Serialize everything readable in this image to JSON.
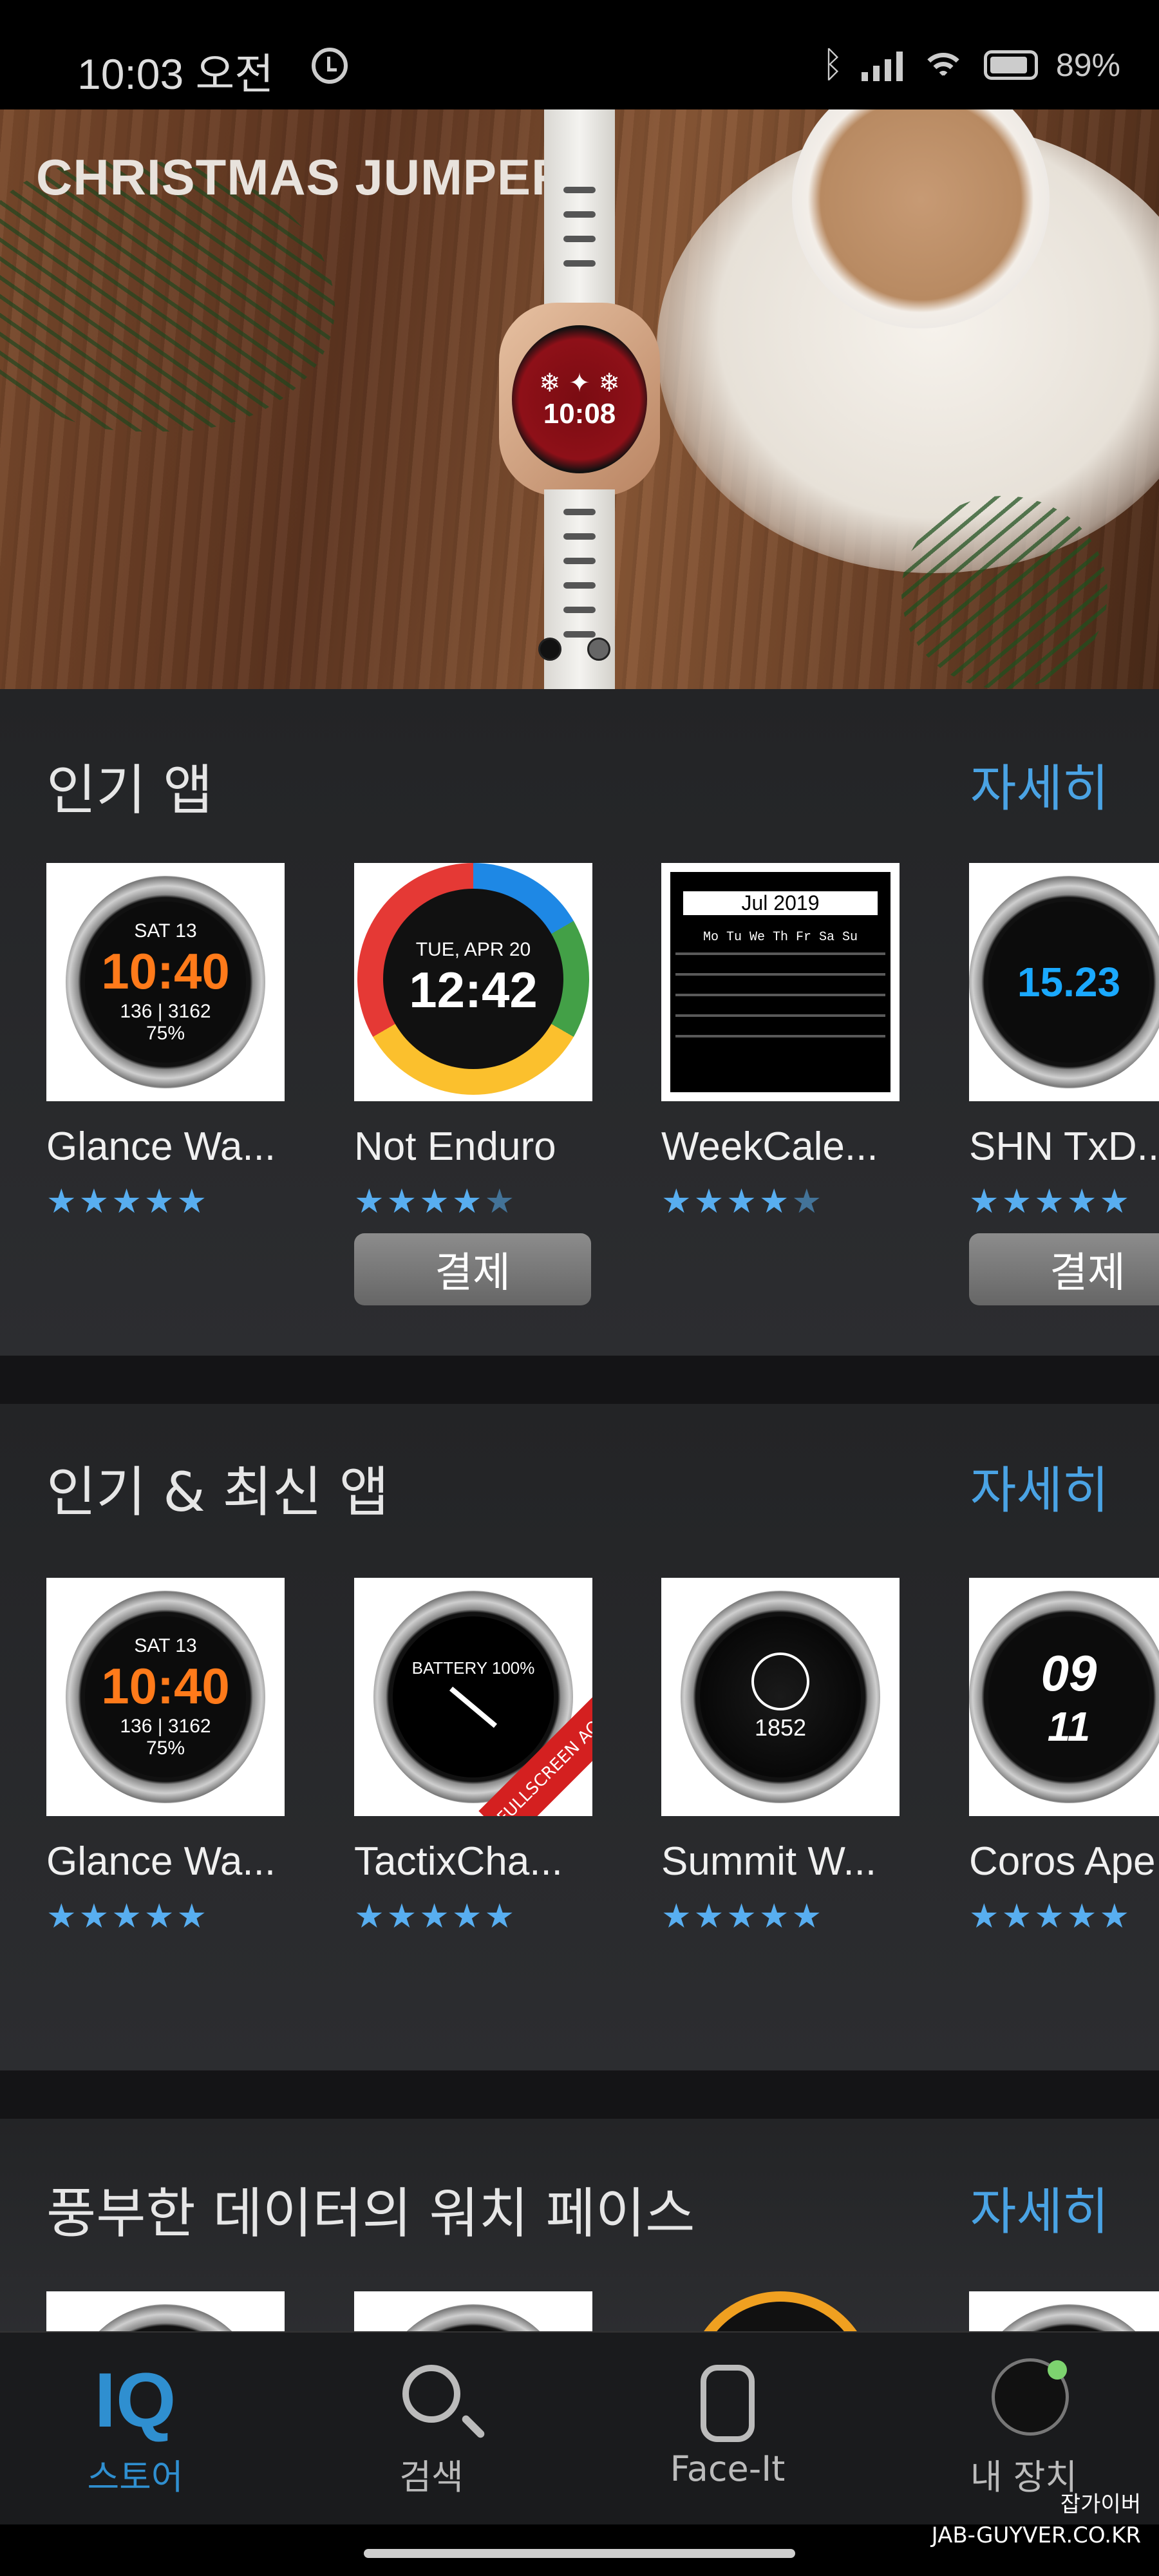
{
  "status_bar": {
    "time": "10:03 오전",
    "battery": "89%"
  },
  "banner": {
    "title": "CHRISTMAS JUMPER",
    "watch_time": "10:08",
    "slide_count": 2,
    "active_slide": 1
  },
  "sections": [
    {
      "title": "인기 앱",
      "more_label": "자세히",
      "apps": [
        {
          "name": "Glance Wa...",
          "rating": 5,
          "has_pay": false
        },
        {
          "name": "Not Enduro",
          "rating": 4.5,
          "has_pay": true,
          "pay_label": "결제"
        },
        {
          "name": "WeekCale...",
          "rating": 4.5,
          "has_pay": false
        },
        {
          "name": "SHN TxD...",
          "rating": 5,
          "has_pay": true,
          "pay_label": "결제"
        }
      ]
    },
    {
      "title": "인기 & 최신 앱",
      "more_label": "자세히",
      "apps": [
        {
          "name": "Glance Wa...",
          "rating": 5
        },
        {
          "name": "TactixCha...",
          "rating": 5
        },
        {
          "name": "Summit W...",
          "rating": 5
        },
        {
          "name": "Coros Ape",
          "rating": 5
        }
      ]
    },
    {
      "title": "풍부한 데이터의 워치 페이스",
      "more_label": "자세히"
    }
  ],
  "thumb_text": {
    "glance_day": "SAT 13",
    "glance_time": "10:40",
    "glance_stats": "136 | 3162",
    "glance_pct": "75%",
    "enduro_date": "TUE, APR 20",
    "enduro_time": "12:42",
    "calendar_month": "Jul 2019",
    "calendar_head": "Mo Tu We Th Fr Sa Su",
    "shn_value": "15.23",
    "tactix_label": "FULLSCREEN AOD",
    "summit_value": "1852",
    "coros_hour": "09",
    "coros_min": "11"
  },
  "nav": {
    "items": [
      {
        "label": "스토어",
        "icon": "iq-store-icon",
        "active": true
      },
      {
        "label": "검색",
        "icon": "search-icon",
        "active": false
      },
      {
        "label": "Face-It",
        "icon": "watch-icon",
        "active": false
      },
      {
        "label": "내 장치",
        "icon": "device-icon",
        "active": false
      }
    ],
    "iq_logo": "IQ"
  },
  "watermark": {
    "line1": "잡가이버",
    "line2": "JAB-GUYVER.CO.KR"
  },
  "colors": {
    "accent": "#4aa3e4",
    "star": "#58aef0",
    "section_bg": "#2a2b2e"
  }
}
